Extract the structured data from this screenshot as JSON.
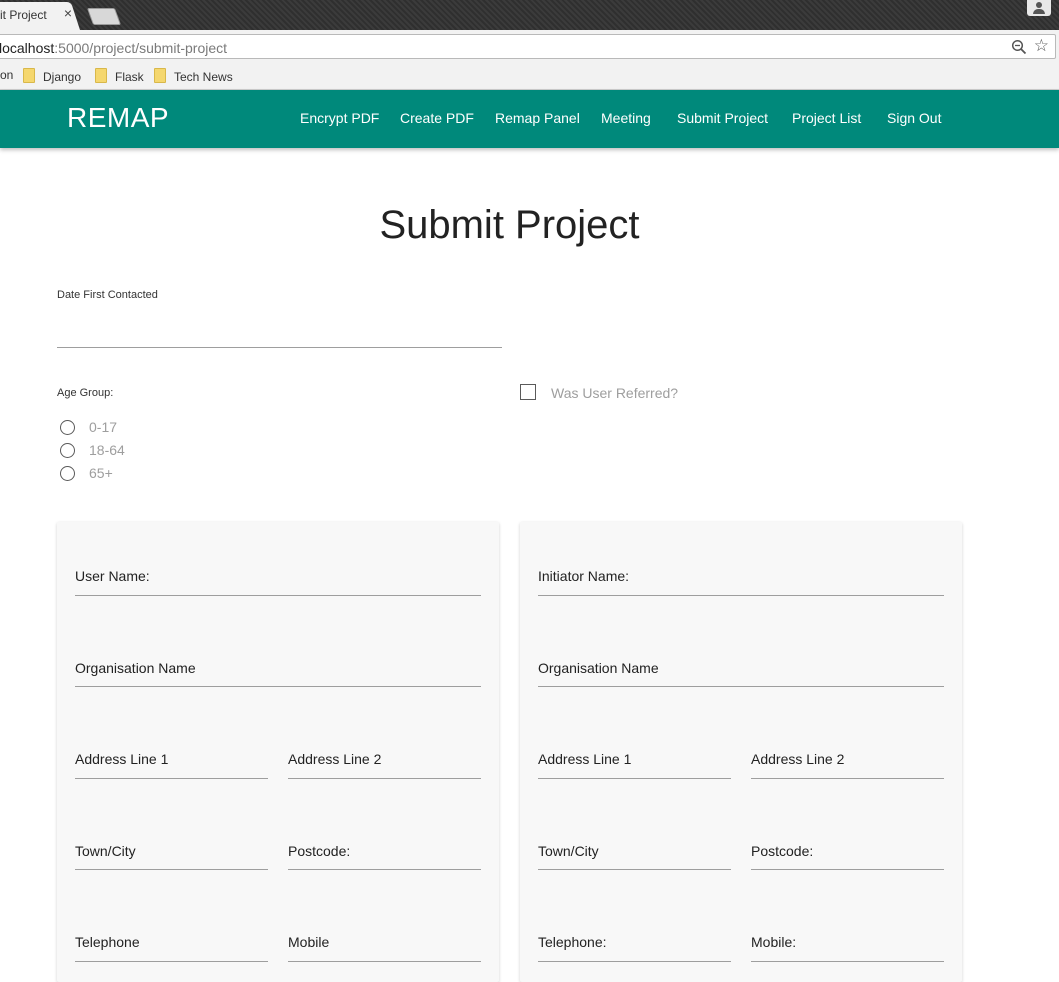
{
  "browser": {
    "tab_title": "it Project",
    "tab_close": "×",
    "url_host": "localhost",
    "url_rest": ":5000/project/submit-project",
    "bookmark_partial": "on",
    "bookmarks": [
      "Django",
      "Flask",
      "Tech News"
    ],
    "star": "☆"
  },
  "nav": {
    "brand": "REMAP",
    "links": [
      "Encrypt PDF",
      "Create PDF",
      "Remap Panel",
      "Meeting",
      "Submit Project",
      "Project List",
      "Sign Out"
    ],
    "color": "#00897b"
  },
  "page": {
    "title": "Submit Project",
    "date_label": "Date First Contacted",
    "age_label": "Age Group:",
    "age_options": [
      "0-17",
      "18-64",
      "65+"
    ],
    "referred_label": "Was User Referred?"
  },
  "user_card": {
    "name": "User Name:",
    "organisation": "Organisation Name",
    "address1": "Address Line 1",
    "address2": "Address Line 2",
    "town": "Town/City",
    "postcode": "Postcode:",
    "telephone": "Telephone",
    "mobile": "Mobile"
  },
  "initiator_card": {
    "name": "Initiator Name:",
    "organisation": "Organisation Name",
    "address1": "Address Line 1",
    "address2": "Address Line 2",
    "town": "Town/City",
    "postcode": "Postcode:",
    "telephone": "Telephone:",
    "mobile": "Mobile:"
  }
}
